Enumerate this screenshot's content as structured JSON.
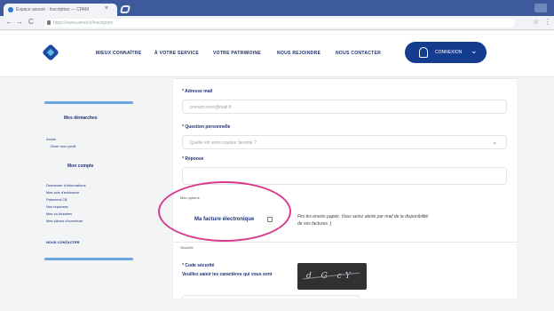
{
  "browser": {
    "tab_title": "Espace assuré · Inscription — CPAM",
    "tab_close": "×",
    "back_glyph": "←",
    "forward_glyph": "→",
    "reload_glyph": "C",
    "url": "https://www.ameli.fr/inscription",
    "menu_glyph": "⋮"
  },
  "header": {
    "nav": [
      "MIEUX CONNAÎTRE",
      "À VOTRE SERVICE",
      "VOTRE PATRIMOINE",
      "NOUS REJOINDRE",
      "NOUS CONTACTER"
    ],
    "connect_label": "CONNEXION",
    "connect_caret": "⌄"
  },
  "sidebar": {
    "section1": "Mes démarches",
    "section1_items": [
      "Accès",
      "· Gérer mon profil"
    ],
    "section2": "Mon compte",
    "section2_items": [
      "Demander d'informations",
      "Mes avis d'échéance",
      "Paiement CB",
      "Nos réponses",
      "Mes co-titulaires",
      "Mes pièces d'ouverture"
    ],
    "footer_link": "NOUS CONTACTER"
  },
  "form": {
    "email_label": "* Adresse mail",
    "email_value": "prenom.nom@mail.fr",
    "question_label": "* Question personnelle",
    "question_value": "Quelle est votre couleur favorite ?",
    "select_caret": "⌄",
    "answer_label": "* Réponse",
    "options_label": "Mes options",
    "checkbox_label": "Ma facture électronique",
    "info_text": "Fini les envois papier. Vous serez alerté par mail de la disponibilité de vos factures. )",
    "security_small": "Sécurité",
    "code_label": "* Code sécurité",
    "code_hint": "Veuillez saisir les caractères qui vous sont",
    "captcha_text": "d G cY"
  },
  "colors": {
    "brand_navy": "#143c8f",
    "accent_light": "#6aa6df",
    "annotation": "#d93a8e"
  }
}
